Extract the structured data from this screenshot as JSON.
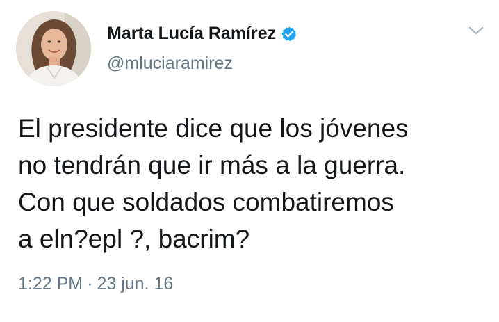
{
  "author": {
    "name": "Marta Lucía Ramírez",
    "handle": "@mluciaramirez",
    "verified": true,
    "verified_icon": "verified-badge-icon",
    "verified_color": "#1da1f2"
  },
  "tweet": {
    "lines": [
      "El presidente dice que los jóvenes",
      "no tendrán que ir más a la guerra.",
      "Con que soldados combatiremos",
      "a eln?epl ?, bacrim?"
    ],
    "time": "1:22 PM",
    "separator": "·",
    "date": "23 jun. 16"
  },
  "menu_icon": "chevron-down-icon"
}
